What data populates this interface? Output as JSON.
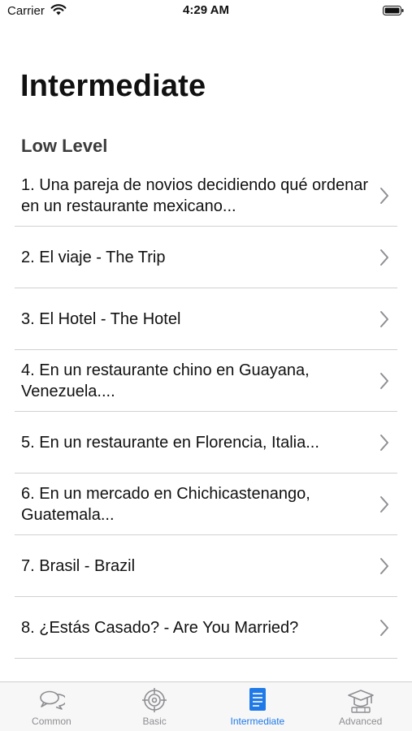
{
  "status": {
    "carrier": "Carrier",
    "time": "4:29 AM"
  },
  "page": {
    "title": "Intermediate",
    "section": "Low Level"
  },
  "items": [
    {
      "label": "1. Una pareja de novios decidiendo qué ordenar en un restaurante mexicano..."
    },
    {
      "label": "2. El viaje - The Trip"
    },
    {
      "label": "3. El Hotel - The Hotel"
    },
    {
      "label": "4. En un restaurante chino en Guayana, Venezuela...."
    },
    {
      "label": "5. En un restaurante en Florencia, Italia..."
    },
    {
      "label": "6. En un mercado en Chichicastenango, Guatemala..."
    },
    {
      "label": "7. Brasil - Brazil"
    },
    {
      "label": "8. ¿Estás Casado? - Are You Married?"
    }
  ],
  "tabs": [
    {
      "label": "Common",
      "icon": "speech-bubbles-icon"
    },
    {
      "label": "Basic",
      "icon": "target-icon"
    },
    {
      "label": "Intermediate",
      "icon": "document-icon",
      "active": true
    },
    {
      "label": "Advanced",
      "icon": "graduation-cap-icon"
    }
  ],
  "colors": {
    "accent": "#1f7ae8",
    "inactive": "#8e8e93",
    "separator": "#d1d1d6"
  }
}
